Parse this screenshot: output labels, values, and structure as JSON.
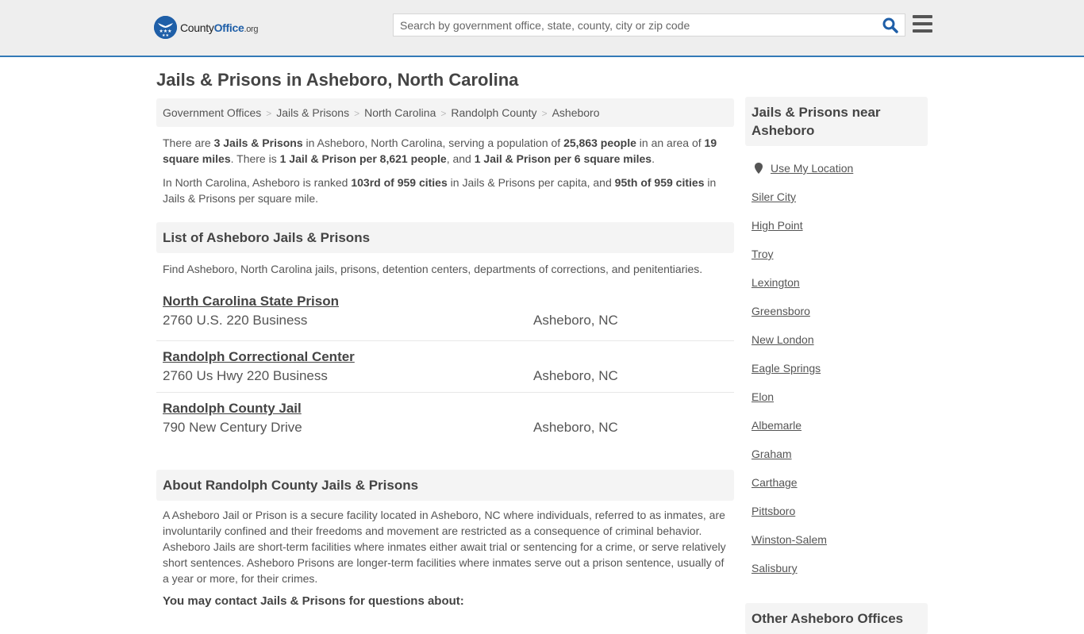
{
  "header": {
    "logo_county": "County",
    "logo_office": "Office",
    "logo_org": ".org",
    "search_placeholder": "Search by government office, state, county, city or zip code",
    "colors": {
      "accent": "#337ab7",
      "logo_blue": "#1f5fa8",
      "topbar_bg": "#eeeeee"
    }
  },
  "page_title": "Jails & Prisons in Asheboro, North Carolina",
  "breadcrumb": [
    "Government Offices",
    "Jails & Prisons",
    "North Carolina",
    "Randolph County",
    "Asheboro"
  ],
  "summary": {
    "p1": {
      "t1": "There are ",
      "b1": "3 Jails & Prisons",
      "t2": " in Asheboro, North Carolina, serving a population of ",
      "b2": "25,863 people",
      "t3": " in an area of ",
      "b3": "19 square miles",
      "t4": ". There is ",
      "b4": "1 Jail & Prison per 8,621 people",
      "t5": ", and ",
      "b5": "1 Jail & Prison per 6 square miles",
      "t6": "."
    },
    "p2": {
      "t1": "In North Carolina, Asheboro is ranked ",
      "b1": "103rd of 959 cities",
      "t2": " in Jails & Prisons per capita, and ",
      "b2": "95th of 959 cities",
      "t3": " in Jails & Prisons per square mile."
    }
  },
  "list_section": {
    "heading": "List of Asheboro Jails & Prisons",
    "description": "Find Asheboro, North Carolina jails, prisons, detention centers, departments of corrections, and penitentiaries.",
    "items": [
      {
        "name": "North Carolina State Prison",
        "address": "2760 U.S. 220 Business",
        "city": "Asheboro, NC"
      },
      {
        "name": "Randolph Correctional Center",
        "address": "2760 Us Hwy 220 Business",
        "city": "Asheboro, NC"
      },
      {
        "name": "Randolph County Jail",
        "address": "790 New Century Drive",
        "city": "Asheboro, NC"
      }
    ]
  },
  "about_section": {
    "heading": "About Randolph County Jails & Prisons",
    "text": "A Asheboro Jail or Prison is a secure facility located in Asheboro, NC where individuals, referred to as inmates, are involuntarily confined and their freedoms and movement are restricted as a consequence of criminal behavior. Asheboro Jails are short-term facilities where inmates either await trial or sentencing for a crime, or serve relatively short sentences. Asheboro Prisons are longer-term facilities where inmates serve out a prison sentence, usually of a year or more, for their crimes.",
    "contact_heading": "You may contact Jails & Prisons for questions about:"
  },
  "sidebar": {
    "heading": "Jails & Prisons near Asheboro",
    "use_location": "Use My Location",
    "links": [
      "Siler City",
      "High Point",
      "Troy",
      "Lexington",
      "Greensboro",
      "New London",
      "Eagle Springs",
      "Elon",
      "Albemarle",
      "Graham",
      "Carthage",
      "Pittsboro",
      "Winston-Salem",
      "Salisbury"
    ],
    "heading2": "Other Asheboro Offices"
  }
}
